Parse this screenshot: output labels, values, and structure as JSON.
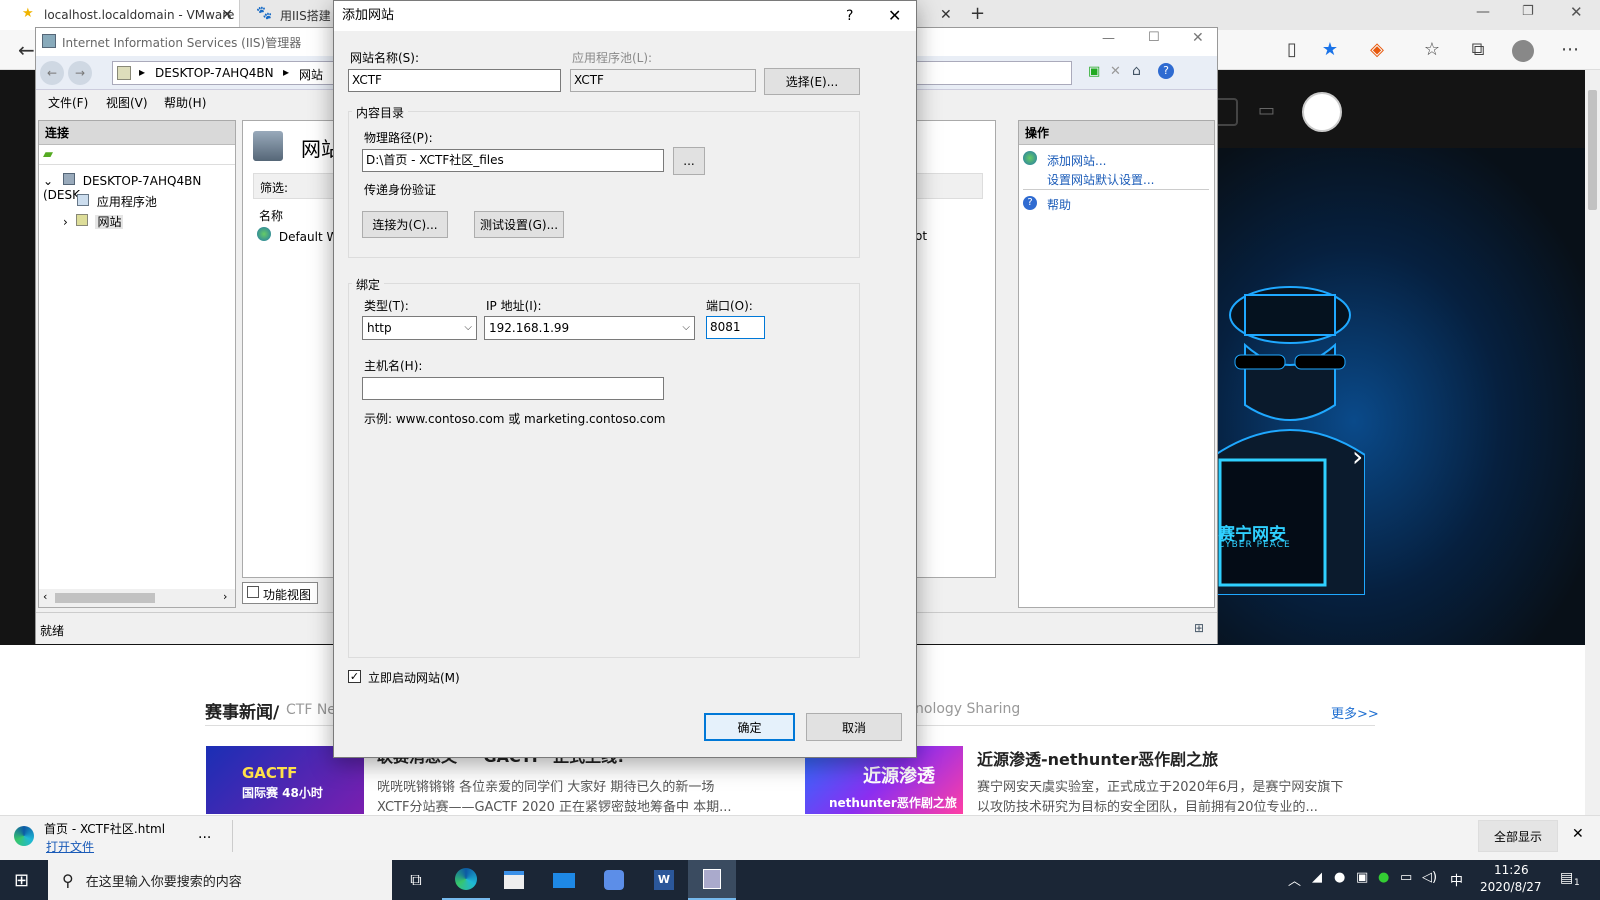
{
  "browser": {
    "tabs": [
      {
        "label": "localhost.localdomain - VMware"
      },
      {
        "label": "用IIS搭建"
      }
    ],
    "new_tab": "+"
  },
  "webpage": {
    "hero": {
      "brand_cn": "赛宁网安",
      "brand_en": "CYBER PEACE"
    },
    "news": {
      "heading": "赛事新闻/",
      "heading_sub": "CTF Ne",
      "heading_right": "nology Sharing",
      "more": "更多>>",
      "articles": [
        {
          "title": "联赛消息又一“GACTF”正式上线!",
          "body1": "咣咣咣锵锵锵 各位亲爱的同学们 大家好 期待已久的新一场",
          "body2": "XCTF分站赛——GACTF 2020 正在紧锣密鼓地筹备中 本期...",
          "thumb_text1": "GACTF",
          "thumb_text2": "国际赛 48小时"
        },
        {
          "title": "近源渗透-nethunter恶作剧之旅",
          "body1": "赛宁网安天虞实验室，正式成立于2020年6月，是赛宁网安旗下",
          "body2": "以攻防技术研究为目标的安全团队，目前拥有20位专业的...",
          "thumb_text1": "近源渗透",
          "thumb_text2": "nethunter恶作剧之旅"
        }
      ]
    }
  },
  "download_bar": {
    "filename": "首页 - XCTF社区.html",
    "open": "打开文件",
    "more": "...",
    "show_all": "全部显示"
  },
  "taskbar": {
    "search_placeholder": "在这里输入你要搜索的内容",
    "time": "11:26",
    "date": "2020/8/27",
    "ime": "中",
    "notifications": "1"
  },
  "iis": {
    "title": "Internet Information Services (IIS)管理器",
    "breadcrumb": [
      "DESKTOP-7AHQ4BN",
      "网站"
    ],
    "menu": [
      "文件(F)",
      "视图(V)",
      "帮助(H)"
    ],
    "connections": {
      "header": "连接",
      "tree": [
        {
          "label": "DESKTOP-7AHQ4BN (DESK"
        },
        {
          "label": "应用程序池"
        },
        {
          "label": "网站"
        }
      ]
    },
    "center": {
      "title": "网站",
      "filter": "筛选:",
      "col_name": "名称",
      "row1": "Default W",
      "row1_path": "root",
      "feature_view": "功能视图"
    },
    "actions": {
      "header": "操作",
      "items": [
        "添加网站...",
        "设置网站默认设置...",
        "帮助"
      ]
    },
    "status": "就绪"
  },
  "dialog": {
    "title": "添加网站",
    "help": "?",
    "site_name_label": "网站名称(S):",
    "site_name_value": "XCTF",
    "app_pool_label": "应用程序池(L):",
    "app_pool_value": "XCTF",
    "select_button": "选择(E)...",
    "content_group": "内容目录",
    "physical_path_label": "物理路径(P):",
    "physical_path_value": "D:\\首页 - XCTF社区_files",
    "browse_button": "...",
    "passthrough_label": "传递身份验证",
    "connect_as_button": "连接为(C)...",
    "test_settings_button": "测试设置(G)...",
    "binding_group": "绑定",
    "type_label": "类型(T):",
    "type_value": "http",
    "ip_label": "IP 地址(I):",
    "ip_value": "192.168.1.99",
    "port_label": "端口(O):",
    "port_value": "8081",
    "host_label": "主机名(H):",
    "host_value": "",
    "example": "示例: www.contoso.com 或 marketing.contoso.com",
    "start_checkbox_label": "立即启动网站(M)",
    "start_checked": true,
    "ok_button": "确定",
    "cancel_button": "取消"
  }
}
